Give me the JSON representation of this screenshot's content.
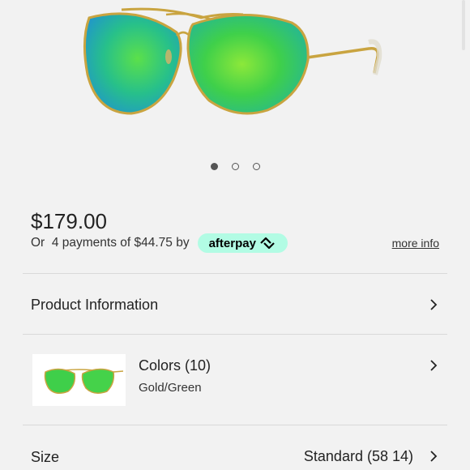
{
  "gallery": {
    "image": "aviator-sunglasses-green-mirror-icon",
    "dots": [
      true,
      false,
      false
    ]
  },
  "price": {
    "amount": "$179.00",
    "installments": "Or  4 payments of $44.75 by",
    "provider": "afterpay",
    "provider_icon": "afterpay-arrows-icon",
    "more_info": "more info",
    "badge_color": "#b2fce4"
  },
  "rows": {
    "product_information": "Product Information",
    "colors_title": "Colors (10)",
    "colors_selected": "Gold/Green",
    "size_label": "Size",
    "size_value": "Standard (58 14)"
  }
}
